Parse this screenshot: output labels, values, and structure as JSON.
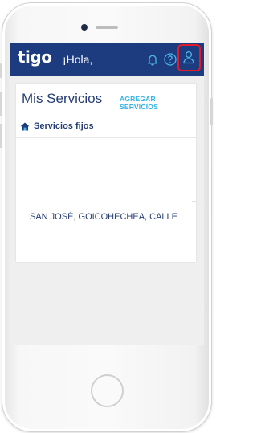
{
  "header": {
    "logo_text": "tigo",
    "greeting": "¡Hola,",
    "icons": [
      "bell-icon",
      "help-icon",
      "user-profile-icon"
    ],
    "highlight_color": "#e21b2c",
    "bar_color": "#1c3c7f"
  },
  "services_card": {
    "title": "Mis Servicios",
    "add_link": "AGREGAR SERVICIOS",
    "section_label": "Servicios fijos",
    "section_icon": "home-icon",
    "address": "SAN JOSÉ, GOICOHECHEA, CALLE"
  },
  "colors": {
    "accent_link": "#32b3e8",
    "text_primary": "#253d74"
  }
}
